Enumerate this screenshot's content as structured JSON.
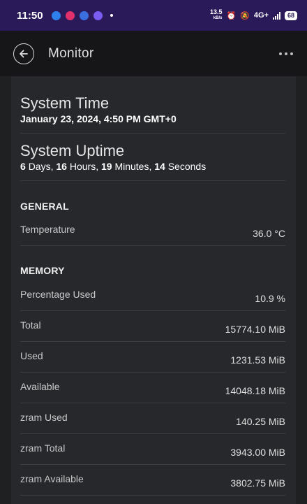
{
  "statusbar": {
    "time": "11:50",
    "net_speed": "13.5",
    "net_unit": "kB/s",
    "network": "4G+",
    "battery": "68"
  },
  "appbar": {
    "title": "Monitor"
  },
  "system": {
    "time_label": "System Time",
    "time_value": "January 23, 2024, 4:50 PM GMT+0",
    "uptime_label": "System Uptime",
    "uptime": {
      "days": "6",
      "days_unit": "Days,",
      "hours": "16",
      "hours_unit": "Hours,",
      "minutes": "19",
      "minutes_unit": "Minutes,",
      "seconds": "14",
      "seconds_unit": "Seconds"
    }
  },
  "general": {
    "header": "GENERAL",
    "rows": [
      {
        "label": "Temperature",
        "value": "36.0 °C"
      }
    ]
  },
  "memory": {
    "header": "MEMORY",
    "rows": [
      {
        "label": "Percentage Used",
        "value": "10.9 %"
      },
      {
        "label": "Total",
        "value": "15774.10 MiB"
      },
      {
        "label": "Used",
        "value": "1231.53 MiB"
      },
      {
        "label": "Available",
        "value": "14048.18 MiB"
      },
      {
        "label": "zram Used",
        "value": "140.25 MiB"
      },
      {
        "label": "zram Total",
        "value": "3943.00 MiB"
      },
      {
        "label": "zram Available",
        "value": "3802.75 MiB"
      }
    ]
  }
}
